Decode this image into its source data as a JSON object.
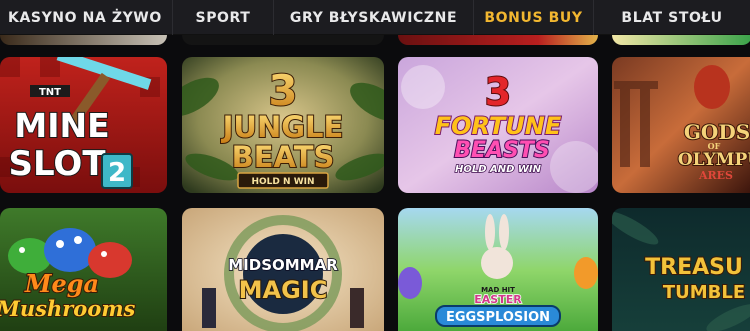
{
  "nav": {
    "items": [
      {
        "label": "KASYNO NA ŻYWO",
        "active": false
      },
      {
        "label": "SPORT",
        "active": false
      },
      {
        "label": "GRY BŁYSKAWICZNE",
        "active": false
      },
      {
        "label": "BONUS BUY",
        "active": true
      },
      {
        "label": "BLAT STOŁU",
        "active": false
      }
    ],
    "active_color": "#f2b730"
  },
  "games": [
    {
      "title_lines": [
        "MINE",
        "SLOT"
      ],
      "top": "TNT",
      "badge": "2"
    },
    {
      "title_lines": [
        "3",
        "JUNGLE",
        "BEATS"
      ],
      "badge": "HOLD N WIN"
    },
    {
      "title_lines": [
        "3",
        "FORTUNE",
        "BEASTS"
      ],
      "badge": "HOLD AND WIN"
    },
    {
      "title_lines": [
        "GODS",
        "OF",
        "OLYMPU",
        "ARES"
      ]
    },
    {
      "title_lines": [
        "Mega",
        "Mushrooms"
      ]
    },
    {
      "title_lines": [
        "MIDSOMMAR",
        "MAGIC"
      ]
    },
    {
      "title_lines": [
        "MAD HIT",
        "EASTER",
        "EGGSPLOSION"
      ]
    },
    {
      "title_lines": [
        "TREASU",
        "TUMBLE"
      ]
    }
  ]
}
